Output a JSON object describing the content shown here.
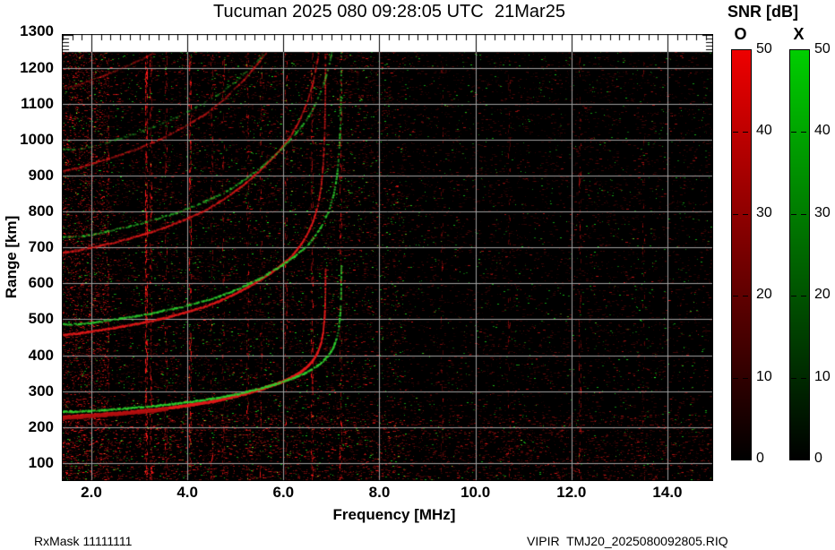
{
  "title": {
    "left": "Tucuman 2025 080 09:28:05 UTC",
    "right": "21Mar25"
  },
  "axes": {
    "x_label": "Frequency [MHz]",
    "y_label": "Range [km]",
    "x_tick_values": [
      2,
      4,
      6,
      8,
      10,
      12,
      14
    ],
    "x_tick_labels": [
      "2.0",
      "4.0",
      "6.0",
      "8.0",
      "10.0",
      "12.0",
      "14.0"
    ],
    "y_tick_values": [
      1300,
      1200,
      1100,
      1000,
      900,
      800,
      700,
      600,
      500,
      400,
      300,
      200,
      100
    ],
    "y_tick_labels": [
      "1300",
      "1200",
      "1100",
      "1000",
      "900",
      "800",
      "700",
      "600",
      "500",
      "400",
      "300",
      "200",
      "100"
    ]
  },
  "colorbar": {
    "title": "SNR [dB]",
    "ticks": [
      "50",
      "40",
      "30",
      "20",
      "10",
      "0"
    ],
    "bars": [
      {
        "label": "O",
        "top_color": "#ee0000"
      },
      {
        "label": "X",
        "top_color": "#00ce00"
      }
    ]
  },
  "footer": {
    "left": "RxMask 11111111",
    "right": "VIPIR  TMJ20_2025080092805.RIQ"
  },
  "chart_data": {
    "type": "heatmap",
    "title": "Ionogram: SNR vs frequency and virtual range, O and X polarizations",
    "x_axis": {
      "label": "Frequency [MHz]",
      "min": 1.38,
      "max": 14.95,
      "major_grid_step": 2.0,
      "minor_tick_step": 0.2
    },
    "y_axis": {
      "label": "Range [km]",
      "min": 50,
      "max": 1295,
      "major_grid_step": 100,
      "data_top_km": 1243
    },
    "z_axis": {
      "label": "SNR [dB]",
      "min": 0,
      "max": 50
    },
    "grid_color": "#a0a0a0",
    "background_color": "#000000",
    "o_mode_color": "#e01a1a",
    "x_mode_color": "#2ed12e",
    "f_layer_o_trace_km": [
      [
        1.38,
        228
      ],
      [
        1.7,
        230
      ],
      [
        2.0,
        233
      ],
      [
        2.5,
        238
      ],
      [
        3.0,
        244
      ],
      [
        3.5,
        251
      ],
      [
        4.0,
        260
      ],
      [
        4.4,
        268
      ],
      [
        4.8,
        279
      ],
      [
        5.2,
        292
      ],
      [
        5.6,
        308
      ],
      [
        5.9,
        322
      ],
      [
        6.15,
        336
      ],
      [
        6.35,
        352
      ],
      [
        6.5,
        368
      ],
      [
        6.62,
        386
      ],
      [
        6.72,
        408
      ],
      [
        6.79,
        435
      ],
      [
        6.83,
        465
      ],
      [
        6.86,
        505
      ],
      [
        6.875,
        560
      ],
      [
        6.88,
        640
      ]
    ],
    "foF2_MHz": 6.88,
    "fxF2_MHz": 7.21,
    "x_trace_freq_offset_MHz": 0.33,
    "x_trace_range_offset_km": 15,
    "hops": [
      {
        "n": 1,
        "red_alpha": 1.0,
        "green_alpha": 1.0,
        "red_p": 0.95,
        "green_p": 0.65
      },
      {
        "n": 2,
        "red_alpha": 0.8,
        "green_alpha": 0.85,
        "red_p": 0.8,
        "green_p": 0.5
      },
      {
        "n": 3,
        "red_alpha": 0.62,
        "green_alpha": 0.6,
        "red_p": 0.62,
        "green_p": 0.4
      },
      {
        "n": 4,
        "red_alpha": 0.45,
        "green_alpha": 0.38,
        "red_p": 0.45,
        "green_p": 0.25
      },
      {
        "n": 5,
        "red_alpha": 0.3,
        "green_alpha": 0.18,
        "red_p": 0.3,
        "green_p": 0.1
      }
    ],
    "rfi_streaks": [
      {
        "f": 2.33,
        "s": 0.25
      },
      {
        "f": 3.13,
        "s": 1.0
      },
      {
        "f": 3.24,
        "s": 0.5
      },
      {
        "f": 3.55,
        "s": 0.3
      },
      {
        "f": 4.06,
        "s": 0.55
      },
      {
        "f": 4.5,
        "s": 0.3
      },
      {
        "f": 4.75,
        "s": 0.25
      },
      {
        "f": 5.25,
        "s": 0.3
      },
      {
        "f": 5.52,
        "s": 0.25
      },
      {
        "f": 6.05,
        "s": 0.3
      },
      {
        "f": 6.6,
        "s": 0.5
      },
      {
        "f": 7.19,
        "s": 0.4
      },
      {
        "f": 9.3,
        "s": 0.15
      },
      {
        "f": 10.7,
        "s": 0.18
      },
      {
        "f": 12.17,
        "s": 0.3
      },
      {
        "f": 13.5,
        "s": 0.12
      }
    ],
    "noise": {
      "base_density": 0.085,
      "left_extra_density": 0.055,
      "left_max_f": 8.55,
      "edge_extra_density": 0.16,
      "edge_max_f": 2.35,
      "bottom_extra_density": 0.1,
      "bottom_min_y": 425,
      "green_density": 0.01,
      "green_left_extra": 0.012
    }
  }
}
